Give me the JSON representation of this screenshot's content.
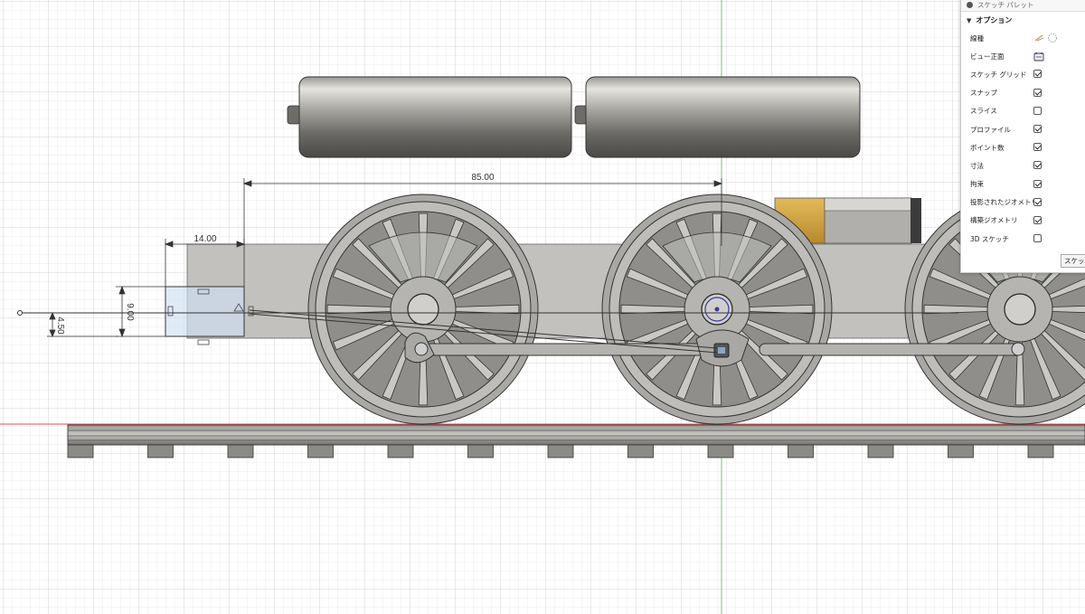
{
  "dimensions": {
    "overall": "85.00",
    "block_width": "14.00",
    "block_height": "9.00",
    "center_offset": "4.50"
  },
  "palette": {
    "title": "スケッチ パレット",
    "section": "オプション",
    "rows": [
      {
        "label": "線種",
        "control": "linetype-icons"
      },
      {
        "label": "ビュー正面",
        "control": "look-at-icon"
      },
      {
        "label": "スケッチ グリッド",
        "checked": true
      },
      {
        "label": "スナップ",
        "checked": true
      },
      {
        "label": "スライス",
        "checked": false
      },
      {
        "label": "プロファイル",
        "checked": true
      },
      {
        "label": "ポイント数",
        "checked": true
      },
      {
        "label": "寸法",
        "checked": true
      },
      {
        "label": "拘束",
        "checked": true
      },
      {
        "label": "投影されたジオメトリ",
        "checked": true
      },
      {
        "label": "構築ジオメトリ",
        "checked": true
      },
      {
        "label": "3D スケッチ",
        "checked": false
      }
    ],
    "finish_label": "スケッチを終了"
  },
  "colors": {
    "grid_minor": "#eeeeee",
    "grid_major": "#dddddd",
    "axis_green": "#7ac27a",
    "axis_red": "#e05050",
    "body_grey": "#bdbcb9",
    "wheel_grey": "#8e8d89",
    "brass": "#c9a042",
    "sketch_blue": "#8fb8e6"
  }
}
